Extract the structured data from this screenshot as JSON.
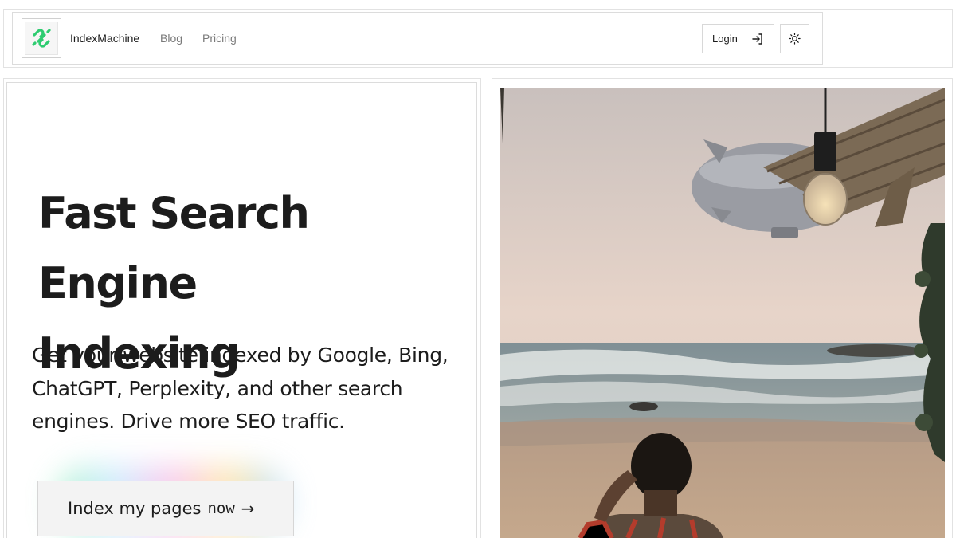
{
  "header": {
    "brand": "IndexMachine",
    "nav": {
      "blog": "Blog",
      "pricing": "Pricing"
    },
    "login_label": "Login",
    "icons": {
      "logo": "link-icon",
      "login": "login-arrow-icon",
      "theme": "sun-icon"
    }
  },
  "hero": {
    "title_line1": "Fast Search Engine",
    "title_line2": "Indexing",
    "subtitle": "Get your website indexed by Google, Bing, ChatGPT, Perplexity, and other search engines. Drive more SEO traffic.",
    "cta_text": "Index my pages",
    "cta_mono": "now",
    "cta_arrow": "→"
  },
  "colors": {
    "accent": "#2ecc71",
    "text": "#1c1c1c",
    "muted": "#7a7a7a"
  }
}
